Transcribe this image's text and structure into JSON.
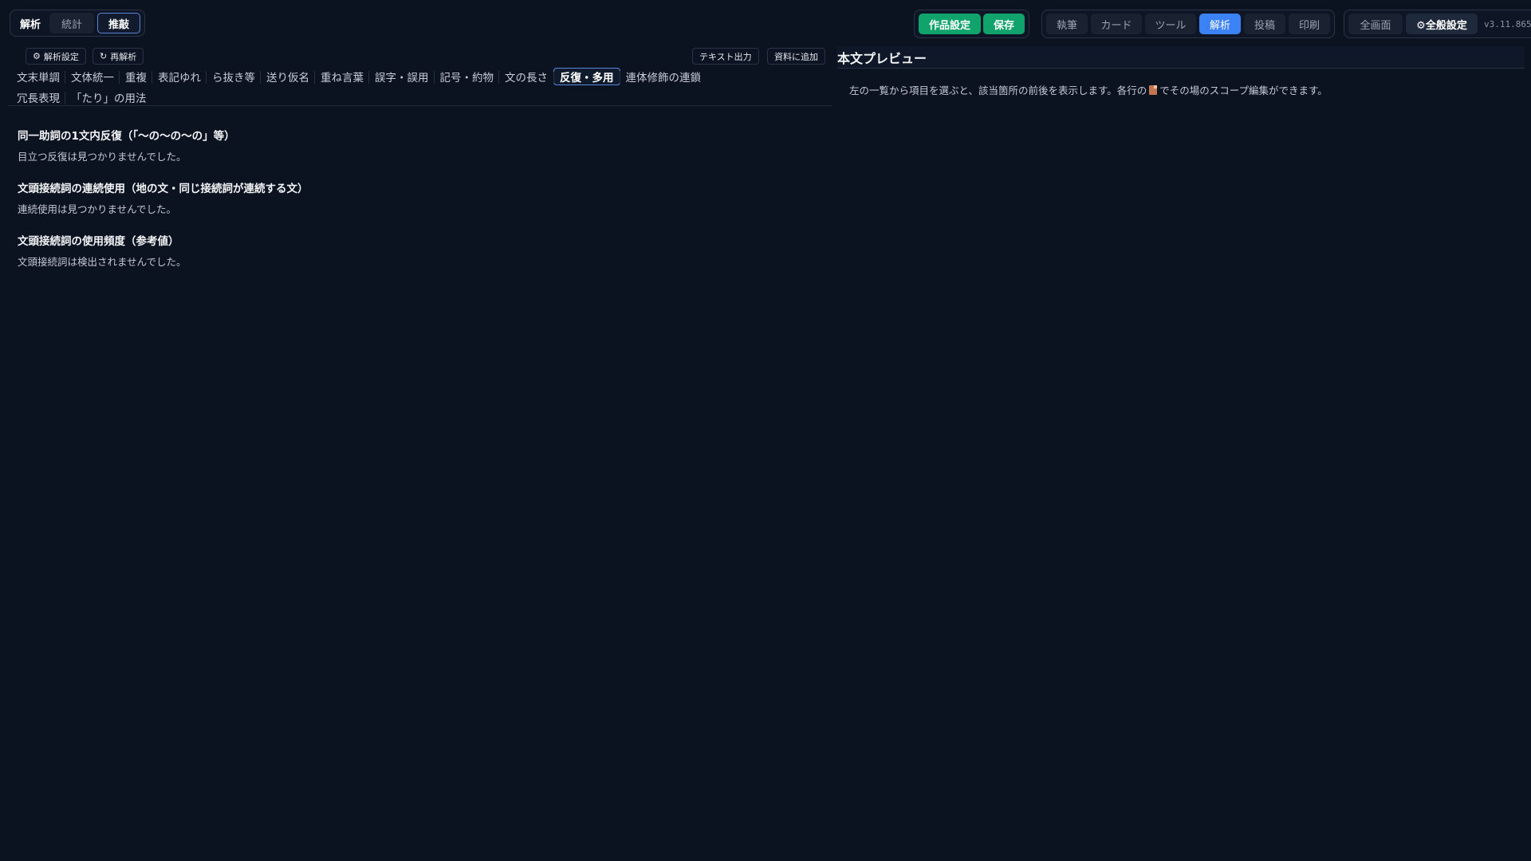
{
  "top_left_tabs": {
    "analysis": "解析",
    "stats": "統計",
    "polish": "推敲"
  },
  "work_actions": {
    "work_settings": "作品設定",
    "save": "保存"
  },
  "modes": [
    "執筆",
    "カード",
    "ツール",
    "解析",
    "投稿",
    "印刷"
  ],
  "modes_active": "解析",
  "global": {
    "fullscreen": "全画面",
    "settings": "⚙全般設定",
    "version": "v3.11.865"
  },
  "analysis_actions": {
    "settings": "解析設定",
    "reanalyze": "再解析",
    "export_text": "テキスト出力",
    "add_to_material": "資料に追加"
  },
  "check_tabs_row1": [
    "文末単調",
    "文体統一",
    "重複",
    "表記ゆれ",
    "ら抜き等",
    "送り仮名",
    "重ね言葉",
    "誤字・誤用",
    "記号・約物",
    "文の長さ",
    "反復・多用",
    "連体修飾の連鎖"
  ],
  "check_tabs_row2": [
    "冗長表現",
    "「たり」の用法"
  ],
  "active_check_tab": "反復・多用",
  "sections": [
    {
      "title": "同一助詞の1文内反復（「〜の〜の〜の」等）",
      "text": "目立つ反復は見つかりませんでした。"
    },
    {
      "title": "文頭接続詞の連続使用（地の文・同じ接続詞が連続する文）",
      "text": "連続使用は見つかりませんでした。"
    },
    {
      "title": "文頭接続詞の使用頻度（参考値）",
      "text": "文頭接続詞は検出されませんでした。"
    }
  ],
  "preview": {
    "title": "本文プレビュー",
    "hint_before": "左の一覧から項目を選ぶと、該当箇所の前後を表示します。各行の",
    "hint_after": "でその場のスコープ編集ができます。"
  },
  "colors": {
    "background": "#0b1220",
    "accent_blue": "#3b82f6",
    "accent_green": "#10a36c",
    "active_border": "#5b86d8"
  },
  "icons": {
    "settings": "gear-icon",
    "reanalyze": "refresh-icon",
    "scope_edit": "document-icon"
  }
}
